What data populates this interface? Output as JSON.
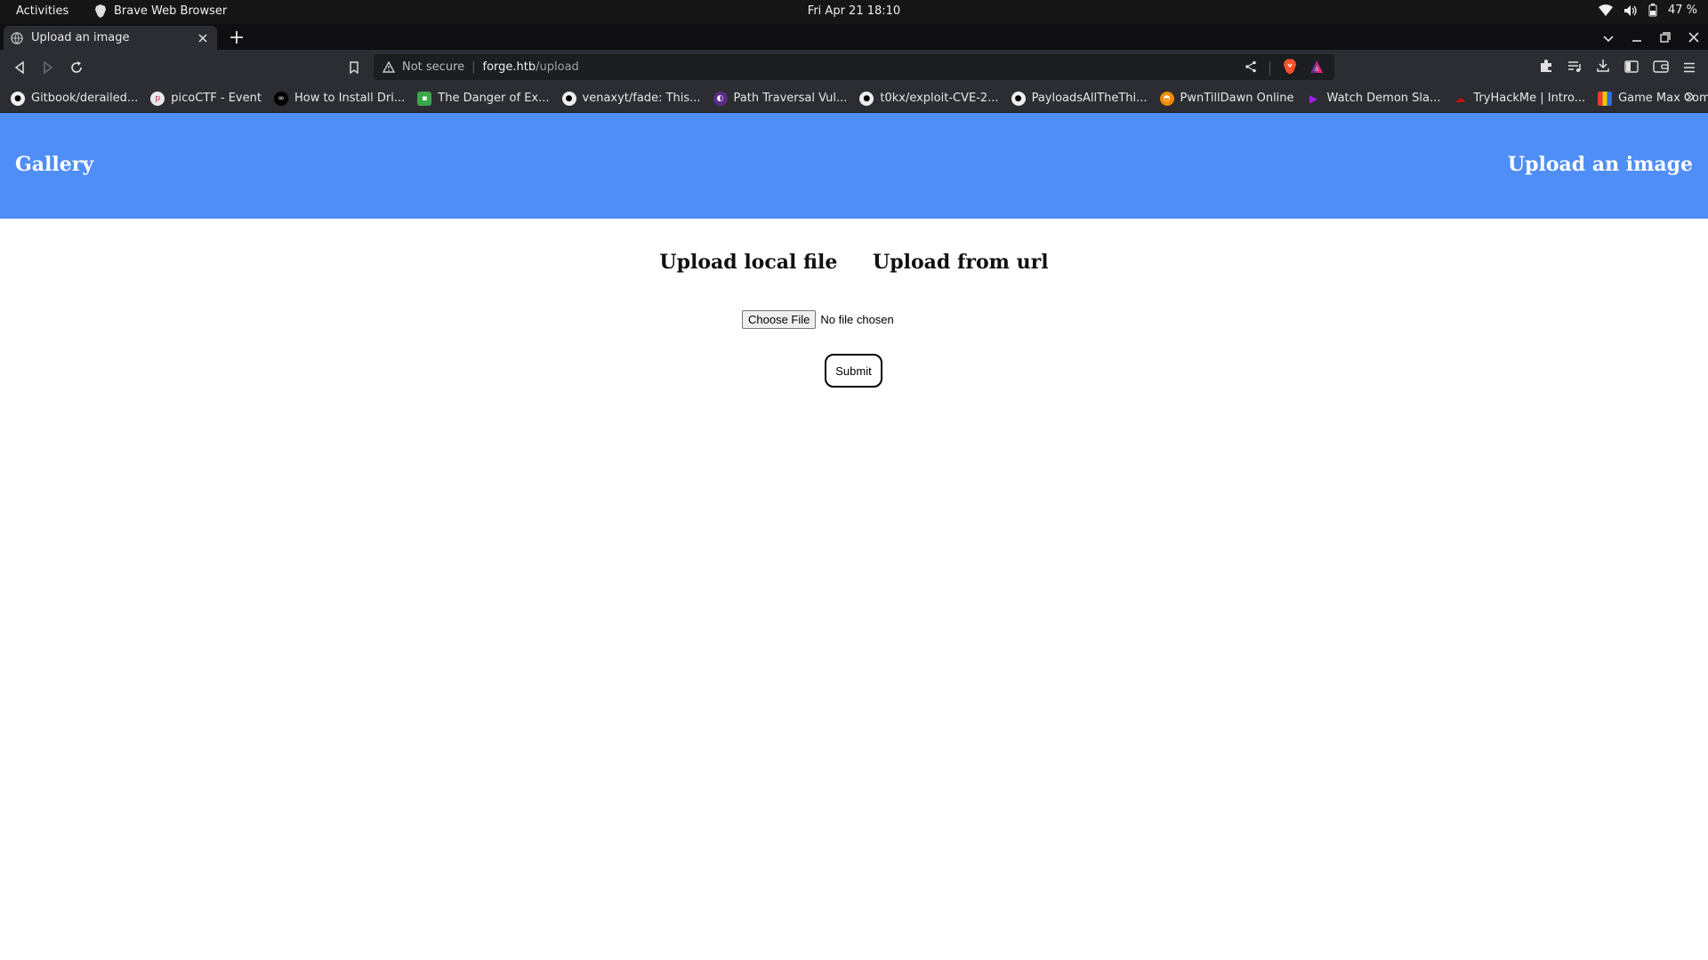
{
  "system_bar": {
    "activities": "Activities",
    "app_name": "Brave Web Browser",
    "clock": "Fri Apr 21  18:10",
    "battery": "47 %"
  },
  "browser": {
    "tab_title": "Upload an image",
    "address": {
      "security_label": "Not secure",
      "host": "forge.htb",
      "path": "/upload"
    },
    "bookmarks": [
      {
        "label": "Gitbook/derailed...",
        "icon": "github-icon"
      },
      {
        "label": "picoCTF - Event",
        "icon": "picoctf-icon"
      },
      {
        "label": "How to Install Dri...",
        "icon": "site-icon"
      },
      {
        "label": "The Danger of Ex...",
        "icon": "lock-icon"
      },
      {
        "label": "venaxyt/fade: This...",
        "icon": "github-icon"
      },
      {
        "label": "Path Traversal Vul...",
        "icon": "site-icon"
      },
      {
        "label": "t0kx/exploit-CVE-2...",
        "icon": "github-icon"
      },
      {
        "label": "PayloadsAllTheThi...",
        "icon": "github-icon"
      },
      {
        "label": "PwnTillDawn Online",
        "icon": "site-icon"
      },
      {
        "label": "Watch Demon Sla...",
        "icon": "play-icon"
      },
      {
        "label": "TryHackMe | Intro...",
        "icon": "tryhackme-icon"
      },
      {
        "label": "Game Max Comm...",
        "icon": "site-icon"
      }
    ]
  },
  "page": {
    "nav": {
      "gallery": "Gallery",
      "upload": "Upload an image"
    },
    "upload_tabs": {
      "local": "Upload local file",
      "url": "Upload from url"
    },
    "file_input": {
      "button": "Choose File",
      "status": "No file chosen"
    },
    "submit": "Submit"
  },
  "colors": {
    "header_bg": "#4f8ef7",
    "browser_chrome": "#2c2d32"
  }
}
